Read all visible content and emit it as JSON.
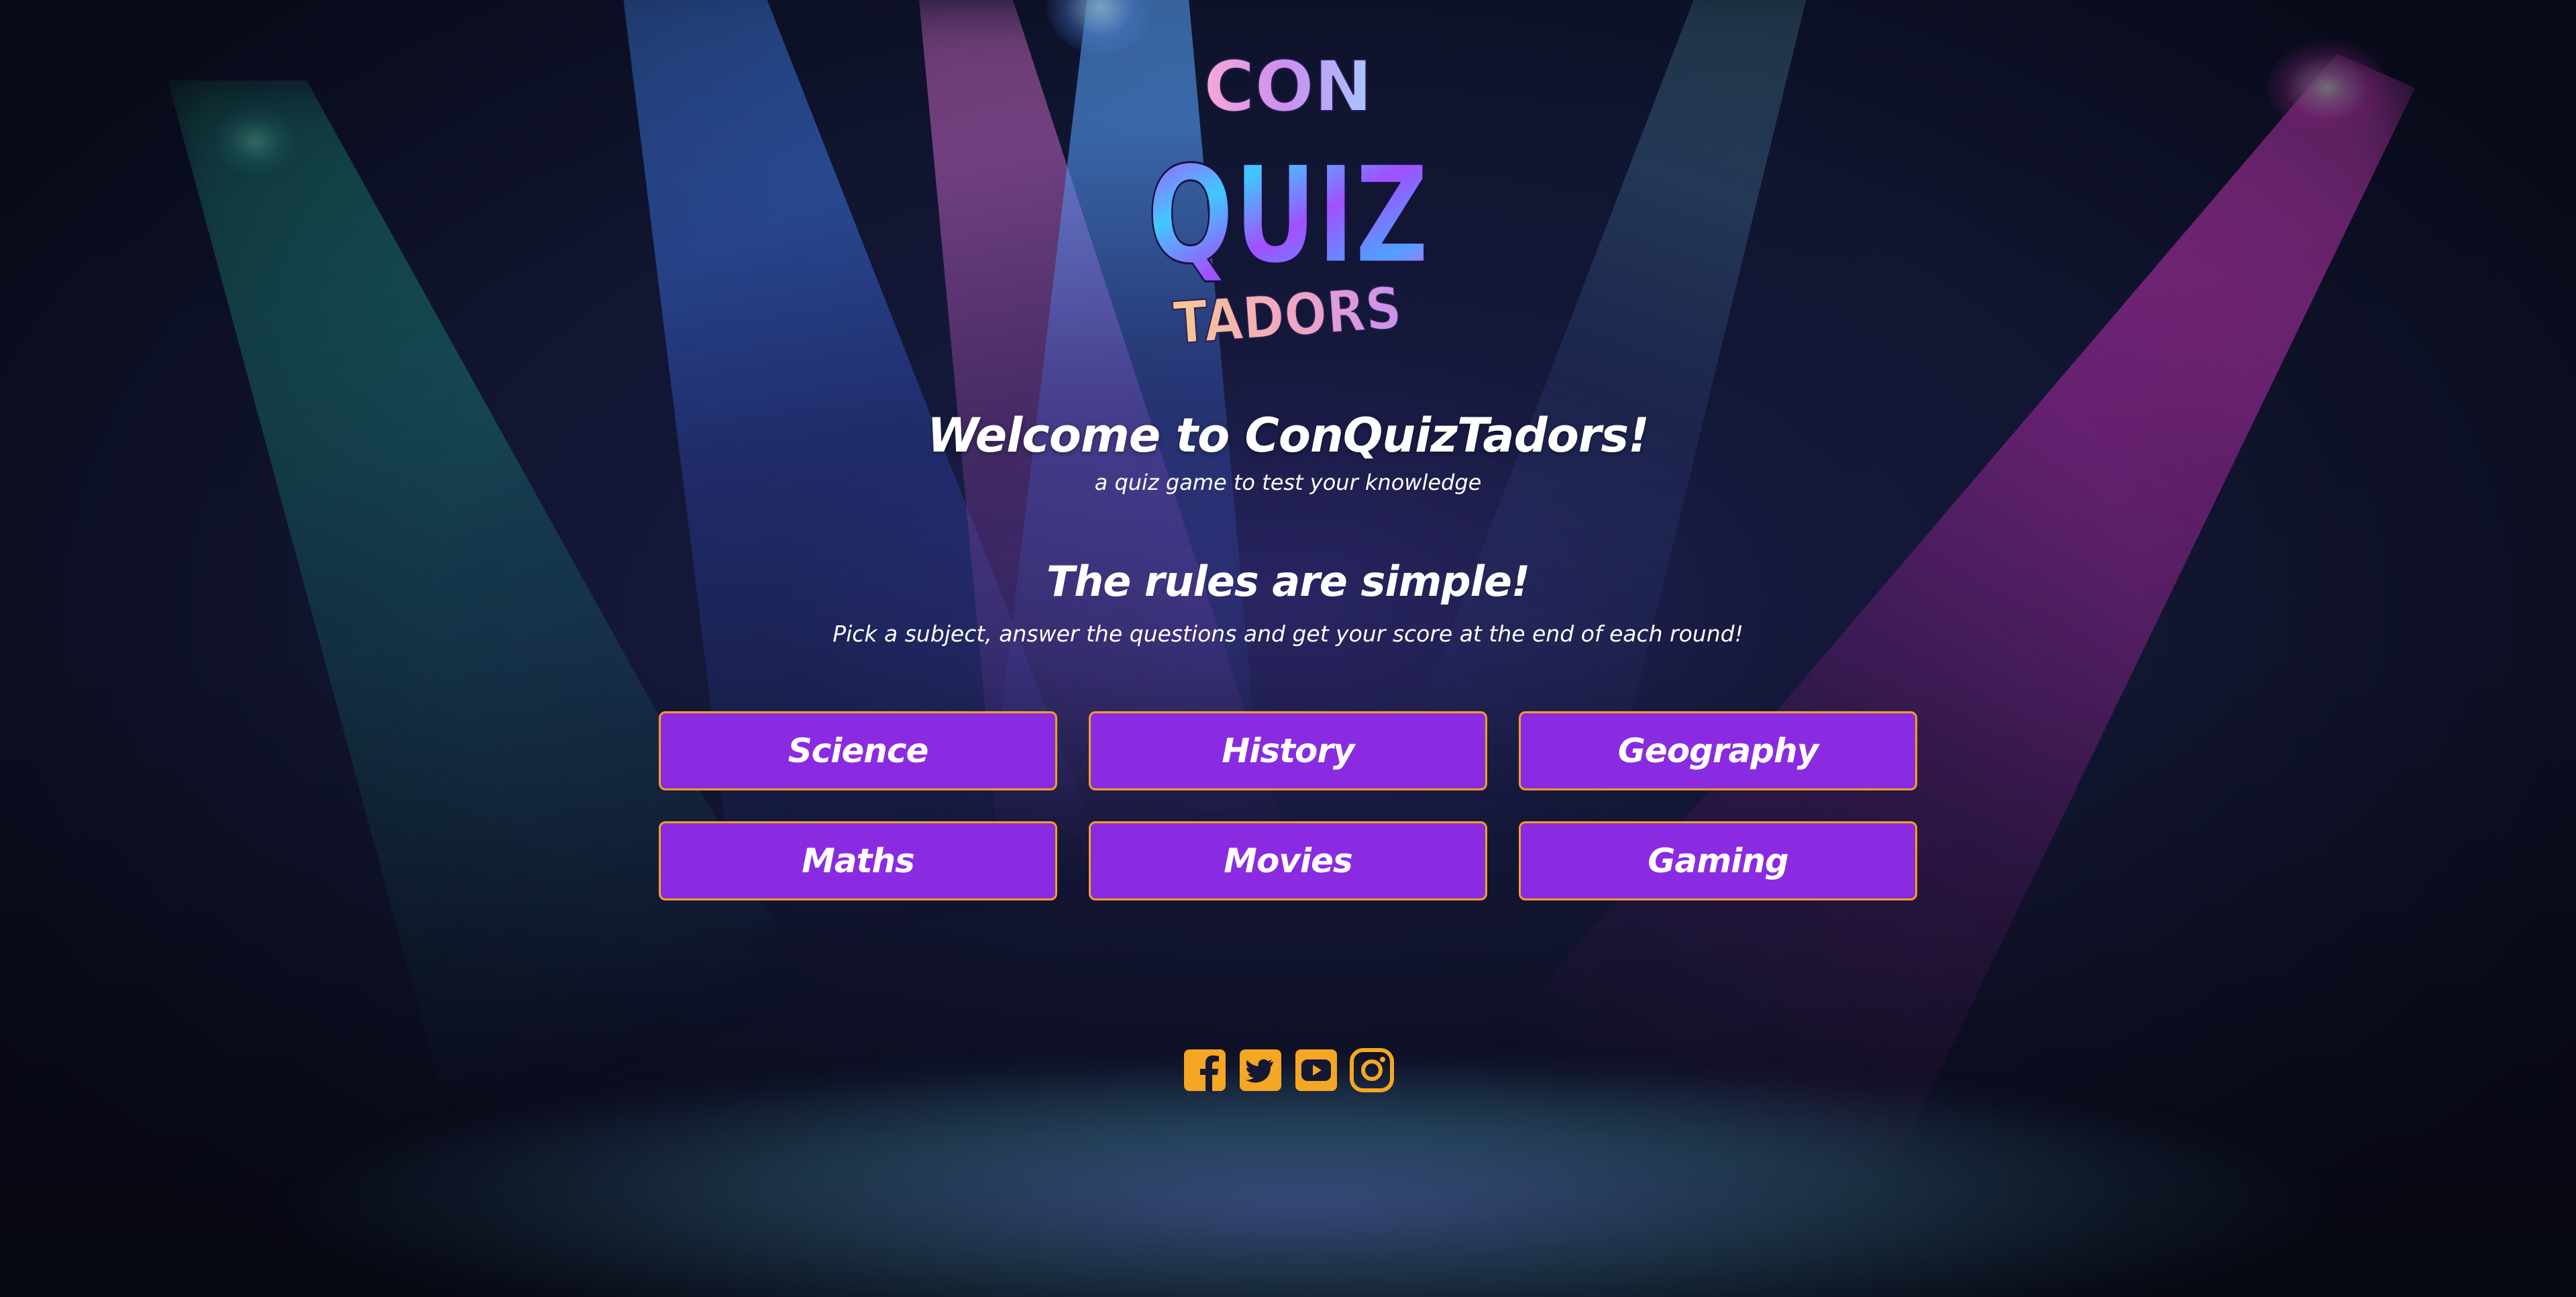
{
  "logo": {
    "line1": "CON",
    "line2": "QUIZ",
    "line3": "TADORS"
  },
  "header": {
    "welcome": "Welcome to ConQuizTadors!",
    "tagline": "a quiz game to test your knowledge"
  },
  "rules": {
    "title": "The rules are simple!",
    "text": "Pick a subject, answer the questions and get your score at the end of each round!"
  },
  "subjects": [
    {
      "label": "Science"
    },
    {
      "label": "History"
    },
    {
      "label": "Geography"
    },
    {
      "label": "Maths"
    },
    {
      "label": "Movies"
    },
    {
      "label": "Gaming"
    }
  ],
  "social": [
    {
      "icon": "facebook-icon"
    },
    {
      "icon": "twitter-icon"
    },
    {
      "icon": "youtube-icon"
    },
    {
      "icon": "instagram-icon"
    }
  ],
  "colors": {
    "button_bg": "#8a2be2",
    "button_border": "#f0a020",
    "social_icon": "#f5a623",
    "text": "#ffffff"
  }
}
